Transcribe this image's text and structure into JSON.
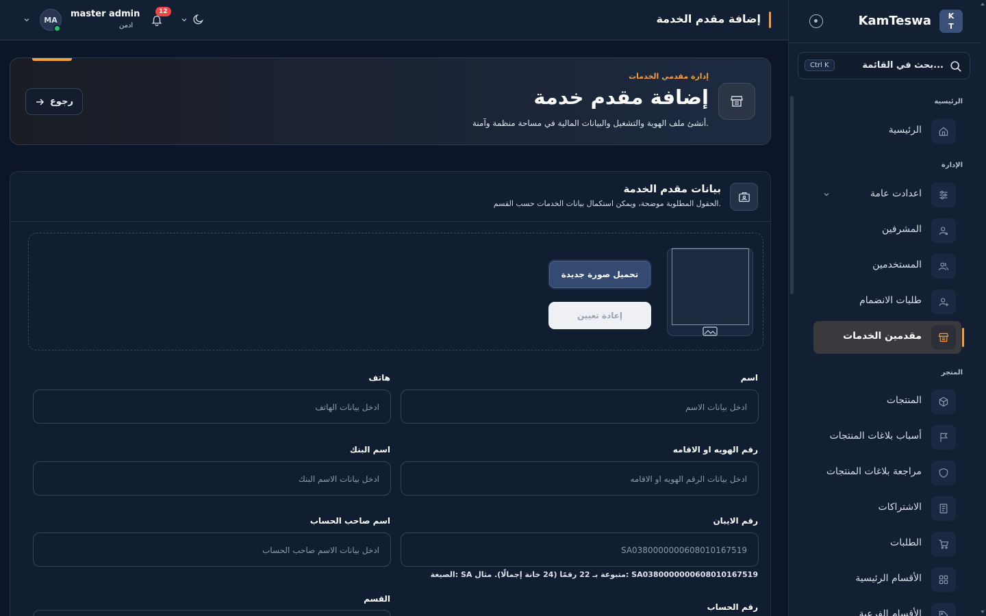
{
  "sidebar": {
    "logo_text_top": "K",
    "logo_text_bottom": "T",
    "brand": "KamTeswa",
    "search_placeholder": "بحث في القائمة...",
    "search_shortcut": "Ctrl K",
    "sections": [
      {
        "label": "الرئيسية"
      },
      {
        "label": "الإدارة"
      },
      {
        "label": "المتجر"
      }
    ],
    "items": [
      {
        "label": "الرئيسية",
        "icon": "home-icon"
      },
      {
        "label": "اعدادت عامة",
        "icon": "sliders-icon"
      },
      {
        "label": "المشرفين",
        "icon": "user-icon"
      },
      {
        "label": "المستخدمين",
        "icon": "users-icon"
      },
      {
        "label": "طلبات الانضمام",
        "icon": "user-plus-icon"
      },
      {
        "label": "مقدمين الخدمات",
        "icon": "store-icon",
        "active": true
      },
      {
        "label": "المنتجات",
        "icon": "box-icon"
      },
      {
        "label": "أسباب بلاغات المنتجات",
        "icon": "flag-icon"
      },
      {
        "label": "مراجعة بلاغات المنتجات",
        "icon": "shield-icon"
      },
      {
        "label": "الاشتراكات",
        "icon": "receipt-icon"
      },
      {
        "label": "الطلبات",
        "icon": "cart-icon"
      },
      {
        "label": "الأقسام الرئيسية",
        "icon": "grid-icon"
      },
      {
        "label": "الأقسام الفرعية",
        "icon": "tag-icon"
      }
    ]
  },
  "topbar": {
    "title": "إضافة مقدم الخدمة",
    "user_name": "master admin",
    "user_role": "ادمن",
    "avatar_initials": "MA",
    "notifications_count": "12"
  },
  "hero": {
    "breadcrumb": "إدارة مقدمي الخدمات",
    "title": "إضافة مقدم خدمة",
    "subtitle": "أنشئ ملف الهوية والتشغيل والبيانات المالية في مساحة منظمة وآمنة.",
    "back_label": "رجوع"
  },
  "form": {
    "title": "بيانات مقدم الخدمة",
    "subtitle": "الحقول المطلوبة موضحة، ويمكن استكمال بيانات الخدمات حسب القسم.",
    "upload_label": "تحميل صورة جديدة",
    "reset_label": "إعادة تعيين",
    "fields": {
      "name_label": "اسم",
      "name_placeholder": "ادخل بيانات الاسم",
      "phone_label": "هاتف",
      "phone_placeholder": "ادخل بيانات الهاتف",
      "id_label": "رقم الهويه او الاقامه",
      "id_placeholder": "ادخل بيانات الرقم الهويه او الاقامه",
      "bank_label": "اسم البنك",
      "bank_placeholder": "ادخل بيانات الاسم البنك",
      "iban_label": "رقم الايبان",
      "iban_value": "SA0380000000608010167519",
      "holder_label": "اسم صاحب الحساب",
      "holder_placeholder": "ادخل بيانات الاسم صاحب الحساب",
      "iban_hint": "الصيغة: SA متبوعة بـ 22 رقمًا (24 خانة إجمالًا). مثال: SA0380000000608010167519",
      "account_label": "رقم الحساب",
      "category_label": "القسم"
    }
  },
  "colors": {
    "accent": "#f59e42",
    "background": "#0c1628",
    "sidebar": "#131f33",
    "online": "#22c55e",
    "badge": "#ef4444"
  }
}
